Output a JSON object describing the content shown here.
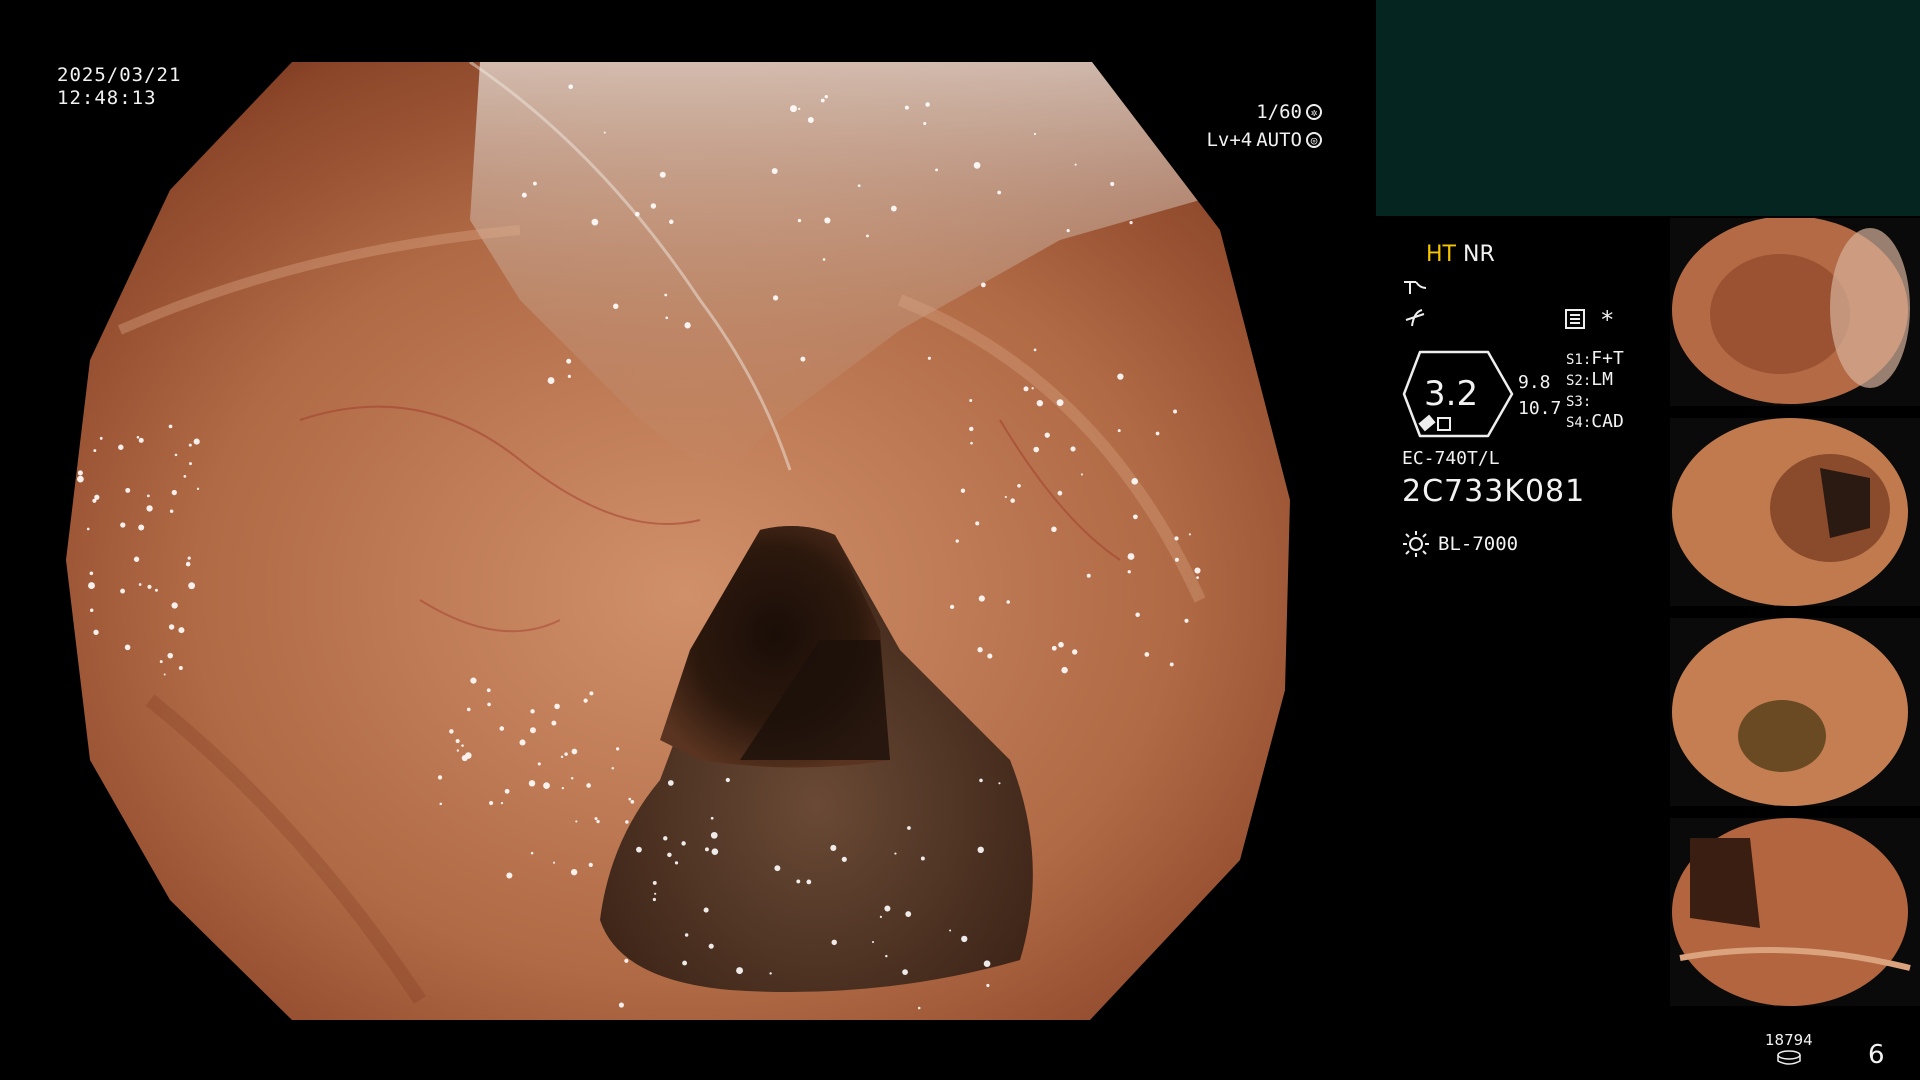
{
  "overlay": {
    "date": "2025/03/21",
    "time": "12:48:13",
    "shutter": "1/60",
    "level": "Lv+4",
    "mode": "AUTO"
  },
  "info": {
    "ht": "HT",
    "nr": "NR",
    "zoom_value": "3.2",
    "val_a": "9.8",
    "val_b": "10.7",
    "s1_label": "S1:",
    "s1_value": "F+T",
    "s2_label": "S2:",
    "s2_value": "LM",
    "s3_label": "S3:",
    "s3_value": "",
    "s4_label": "S4:",
    "s4_value": "CAD",
    "scope_model": "EC-740T/L",
    "serial": "2C733K081",
    "light_source": "BL-7000",
    "star": "*"
  },
  "footer": {
    "count": "18794",
    "page": "6"
  },
  "colors": {
    "panel_bg": "#052620",
    "ht_color": "#f5c400",
    "mucosa": "#b06a45"
  },
  "icons": [
    "sun-icon",
    "structure-icon",
    "color-icon",
    "memory-icon",
    "disk-icon"
  ]
}
